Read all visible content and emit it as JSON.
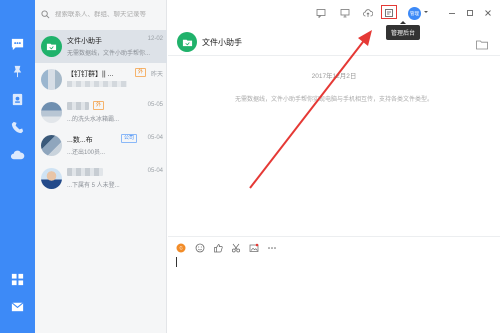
{
  "search": {
    "placeholder": "搜索联系人、群组、聊天记录等"
  },
  "rail": {
    "icons": [
      "chat-icon",
      "pin-icon",
      "contacts-book-icon",
      "phone-icon",
      "cloud-icon",
      "apps-grid-icon",
      "mail-icon"
    ]
  },
  "conversations": [
    {
      "title": "文件小助手",
      "subtitle": "无需数据线，文件小助手帮你...",
      "time": "12-02",
      "tag": "",
      "avatar": "file-assistant"
    },
    {
      "title": "【钉钉群】|| ...",
      "subtitle": "",
      "time": "昨天",
      "tag": "外",
      "avatar": "mosaic"
    },
    {
      "title": "",
      "subtitle": "...的洗头水冰箱霸...",
      "time": "05-05",
      "tag": "外",
      "avatar": "mosaic"
    },
    {
      "title": "...数...布",
      "subtitle": "...还出100员...",
      "time": "05-04",
      "tag": "公司",
      "avatar": "mosaic"
    },
    {
      "title": "",
      "subtitle": "...下属有 5 人未登...",
      "time": "05-04",
      "tag": "",
      "avatar": "photo"
    }
  ],
  "toolbar": {
    "user_badge": "管理",
    "tooltip": "管理后台"
  },
  "chat": {
    "title": "文件小助手",
    "date": "2017年12月2日",
    "notice": "无需数据线，文件小助手帮你实现电脑与手机相互传，支持各类文件类型。"
  },
  "compose": {
    "icons": [
      "gif-icon",
      "emoji-icon",
      "thumbs-up-icon",
      "scissors-icon",
      "image-icon",
      "more-icon"
    ]
  },
  "colors": {
    "brand": "#3d8af7",
    "assistant": "#20b26b",
    "annotation": "#e53935"
  }
}
